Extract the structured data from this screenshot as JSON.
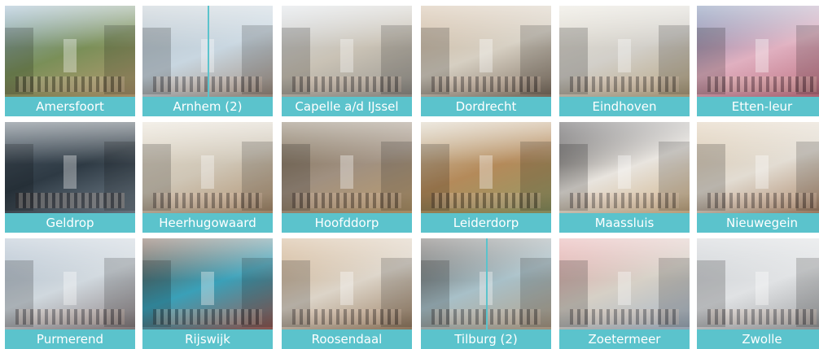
{
  "caption_color": "#5bc3cc",
  "locations": [
    {
      "label": "Amersfoort",
      "photo_colors": [
        "#8fb0c8",
        "#c9a07a",
        "#7a8f58"
      ]
    },
    {
      "label": "Arnhem (2)",
      "photo_colors": [
        "#b8c4cc",
        "#9a7f6a",
        "#c8d6e0"
      ],
      "split": true
    },
    {
      "label": "Capelle a/d IJssel",
      "photo_colors": [
        "#d8dde2",
        "#8d8b86",
        "#c9c2b5"
      ]
    },
    {
      "label": "Dordrecht",
      "photo_colors": [
        "#cdb59a",
        "#6b5a4a",
        "#d6cfc2"
      ]
    },
    {
      "label": "Eindhoven",
      "photo_colors": [
        "#e6e2d6",
        "#b09a6e",
        "#d2cfc9"
      ]
    },
    {
      "label": "Etten-leur",
      "photo_colors": [
        "#6a7fa8",
        "#b25a6a",
        "#e0b0c0"
      ]
    },
    {
      "label": "Geldrop",
      "photo_colors": [
        "#4c5a66",
        "#8a98a4",
        "#2e3a44"
      ]
    },
    {
      "label": "Heerhugowaard",
      "photo_colors": [
        "#e4dccd",
        "#a8845e",
        "#cfc6b6"
      ]
    },
    {
      "label": "Hoofddorp",
      "photo_colors": [
        "#7a6a52",
        "#c4a16a",
        "#a09080"
      ]
    },
    {
      "label": "Leiderdorp",
      "photo_colors": [
        "#d6cbb6",
        "#8aa06a",
        "#b48a5a"
      ]
    },
    {
      "label": "Maassluis",
      "photo_colors": [
        "#3c3a3c",
        "#c8a470",
        "#e8e4de"
      ]
    },
    {
      "label": "Nieuwegein",
      "photo_colors": [
        "#d8c4a8",
        "#9a6c48",
        "#e2dcd2"
      ]
    },
    {
      "label": "Purmerend",
      "photo_colors": [
        "#a8b8c8",
        "#7a6a6a",
        "#d0d8de"
      ]
    },
    {
      "label": "Rijswijk",
      "photo_colors": [
        "#6a4a3a",
        "#b84a3a",
        "#3aa0b8"
      ]
    },
    {
      "label": "Roosendaal",
      "photo_colors": [
        "#c9a67e",
        "#8a6a4a",
        "#dcd4c8"
      ]
    },
    {
      "label": "Tilburg (2)",
      "photo_colors": [
        "#5a5450",
        "#b89a7a",
        "#a8c0c8"
      ],
      "split": true
    },
    {
      "label": "Zoetermeer",
      "photo_colors": [
        "#e2a0a0",
        "#9ab0c8",
        "#d6d0c6"
      ]
    },
    {
      "label": "Zwolle",
      "photo_colors": [
        "#c8ccd0",
        "#8a8c8e",
        "#e0e2e4"
      ]
    }
  ]
}
